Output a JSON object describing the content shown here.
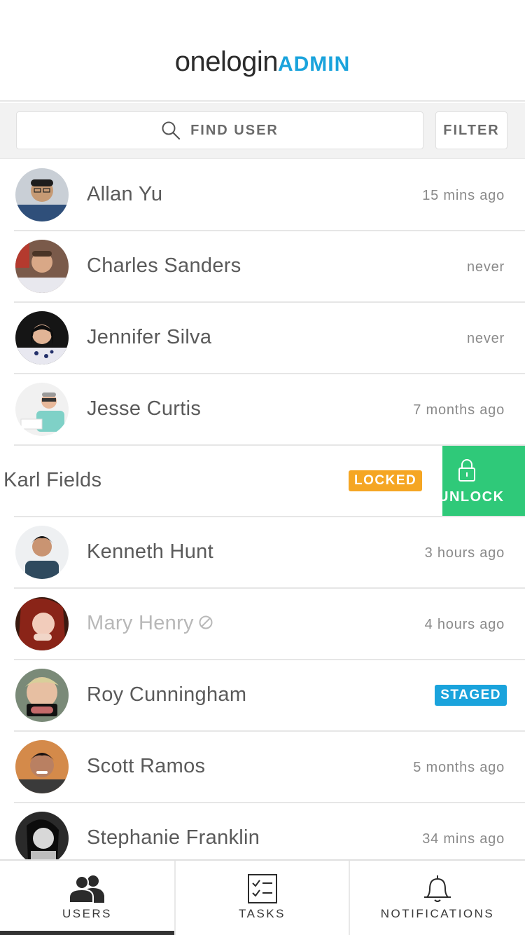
{
  "header": {
    "brand": "onelogin",
    "suffix": "ADMIN"
  },
  "search": {
    "placeholder": "FIND USER",
    "filter_label": "FILTER"
  },
  "users": [
    {
      "name": "Allan Yu",
      "last_login": "15 mins ago"
    },
    {
      "name": "Charles Sanders",
      "last_login": "never"
    },
    {
      "name": "Jennifer Silva",
      "last_login": "never"
    },
    {
      "name": "Jesse Curtis",
      "last_login": "7 months ago"
    },
    {
      "name": "Karl Fields",
      "badge": "LOCKED",
      "action": "UNLOCK"
    },
    {
      "name": "Kenneth Hunt",
      "last_login": "3 hours ago"
    },
    {
      "name": "Mary Henry",
      "last_login": "4 hours ago",
      "status": "disabled"
    },
    {
      "name": "Roy Cunningham",
      "badge": "STAGED"
    },
    {
      "name": "Scott Ramos",
      "last_login": "5 months ago"
    },
    {
      "name": "Stephanie Franklin",
      "last_login": "34 mins ago"
    }
  ],
  "tabs": [
    {
      "label": "USERS",
      "icon": "users-icon",
      "active": true
    },
    {
      "label": "TASKS",
      "icon": "tasks-icon",
      "active": false
    },
    {
      "label": "NOTIFICATIONS",
      "icon": "bell-icon",
      "active": false
    }
  ],
  "colors": {
    "accent": "#1aa3dc",
    "locked": "#f5a623",
    "unlock": "#2fc979",
    "staged": "#1aa3dc"
  }
}
